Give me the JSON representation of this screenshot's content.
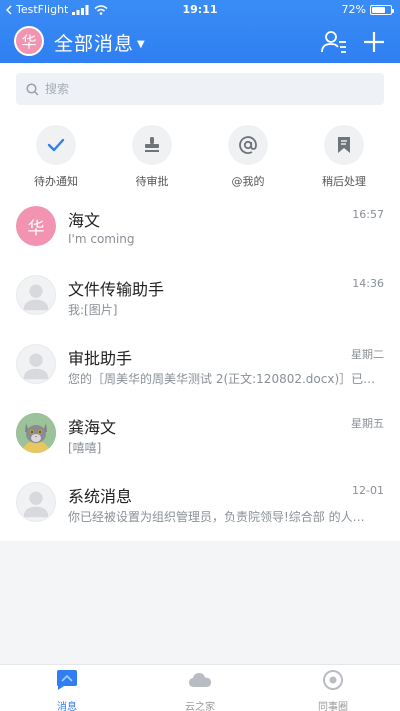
{
  "status_bar": {
    "carrier": "TestFlight",
    "time": "19:11",
    "battery": "72%",
    "battery_level": 0.72
  },
  "header": {
    "avatar_text": "华",
    "title": "全部消息"
  },
  "search": {
    "placeholder": "搜索"
  },
  "quick_actions": [
    {
      "label": "待办通知",
      "icon": "check-icon"
    },
    {
      "label": "待审批",
      "icon": "stamp-icon"
    },
    {
      "label": "@我的",
      "icon": "at-icon"
    },
    {
      "label": "稍后处理",
      "icon": "bookmark-icon"
    }
  ],
  "messages": [
    {
      "name": "海文",
      "preview": "I'm coming",
      "time": "16:57",
      "avatar": "华"
    },
    {
      "name": "文件传输助手",
      "preview": "我:[图片]",
      "time": "14:36"
    },
    {
      "name": "审批助手",
      "preview": "您的［周美华的周美华测试 2(正文:120802.docx)］已…",
      "time": "星期二"
    },
    {
      "name": "龚海文",
      "preview": "[嘻嘻]",
      "time": "星期五"
    },
    {
      "name": "系统消息",
      "preview": "你已经被设置为组织管理员，负责院领导!综合部 的人…",
      "time": "12-01"
    }
  ],
  "tabs": [
    {
      "label": "消息",
      "active": true
    },
    {
      "label": "云之家",
      "active": false
    },
    {
      "label": "同事圈",
      "active": false
    }
  ],
  "colors": {
    "primary": "#2f7ff2",
    "avatar_pink": "#f294b1"
  }
}
